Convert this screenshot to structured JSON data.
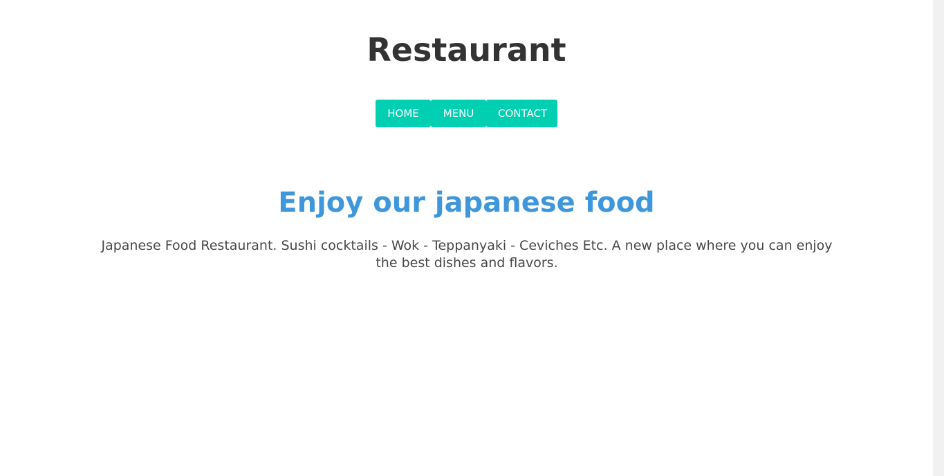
{
  "header": {
    "title": "Restaurant"
  },
  "nav": {
    "items": [
      {
        "label": "HOME"
      },
      {
        "label": "MENU"
      },
      {
        "label": "CONTACT"
      }
    ]
  },
  "hero": {
    "heading": "Enjoy our japanese food",
    "description": "Japanese Food Restaurant. Sushi cocktails - Wok - Teppanyaki - Ceviches Etc. A new place where you can enjoy the best dishes and flavors."
  },
  "colors": {
    "accent": "#00cfb1",
    "heading": "#3f97db",
    "text": "#474747"
  }
}
